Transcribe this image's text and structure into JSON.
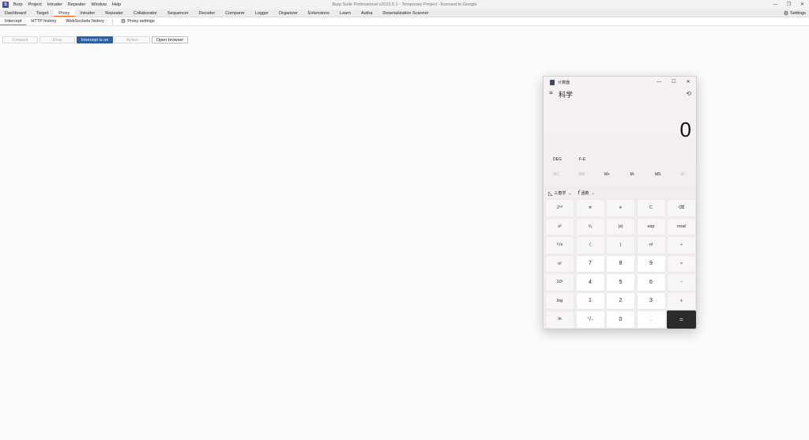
{
  "app": {
    "title": "Burp Suite Professional v2023.5.1 - Temporary Project - licensed to Google",
    "logo_letter": "S",
    "menu": [
      "Burp",
      "Project",
      "Intruder",
      "Repeater",
      "Window",
      "Help"
    ],
    "window_controls": [
      "—",
      "❐",
      "✕"
    ]
  },
  "main_tabs": [
    "Dashboard",
    "Target",
    "Proxy",
    "Intruder",
    "Repeater",
    "Collaborator",
    "Sequencer",
    "Decoder",
    "Comparer",
    "Logger",
    "Organizer",
    "Extensions",
    "Learn",
    "Autha",
    "Deserialization Scanner"
  ],
  "settings_label": "Settings",
  "sub_tabs": [
    "Intercept",
    "HTTP history",
    "WebSockets history"
  ],
  "proxy_settings_label": "Proxy settings",
  "intercept_toolbar": {
    "forward": "Forward",
    "drop": "Drop",
    "intercept": "Intercept is on",
    "action": "Action",
    "open_browser": "Open browser"
  },
  "calculator": {
    "title": "计算器",
    "mode": "科学",
    "display": "0",
    "deg": "DEG",
    "fe": "F-E",
    "memory": [
      "MC",
      "MR",
      "M+",
      "M-",
      "MS",
      "M~"
    ],
    "trig_label": "三角学",
    "func_label": "函数",
    "keys": [
      "2ⁿᵈ",
      "π",
      "e",
      "C",
      "⌫",
      "x²",
      "¹⁄ₓ",
      "|x|",
      "exp",
      "mod",
      "²√x",
      "(",
      ")",
      "n!",
      "÷",
      "xʸ",
      "7",
      "8",
      "9",
      "×",
      "10ˣ",
      "4",
      "5",
      "6",
      "−",
      "log",
      "1",
      "2",
      "3",
      "+",
      "ln",
      "⁺/₋",
      "0",
      ".",
      "="
    ]
  },
  "colors": {
    "accent_tab": "#e8661a",
    "intercept_on": "#2e5f9e",
    "calc_equals": "#2b2b2b"
  }
}
